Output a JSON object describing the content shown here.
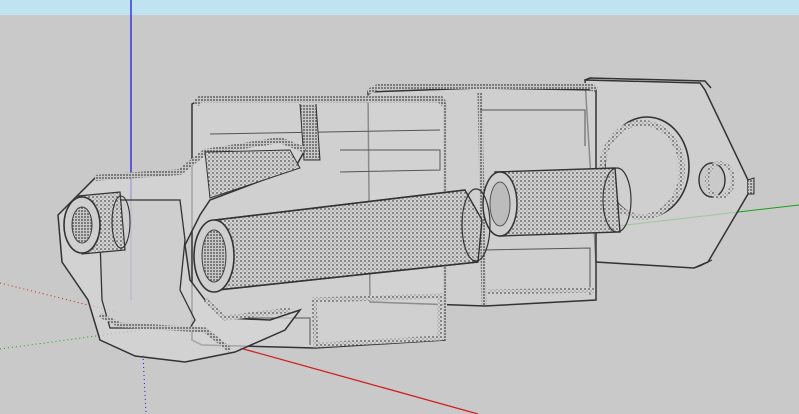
{
  "viewport": {
    "sky_color": "#bfe3f0",
    "ground_color": "#c9c9c9",
    "axis_colors": {
      "red": "#d02020",
      "green": "#18a018",
      "blue": "#2020d8"
    }
  },
  "model": {
    "display_style": "x-ray",
    "line_color": "#3a3a3a",
    "face_color": "#cfcfcf",
    "components": [
      "front-guide-bracket",
      "left-guide-rod",
      "right-guide-rod",
      "main-carriage-block",
      "rear-carriage-block",
      "threaded-rod",
      "motor-mount-plate"
    ]
  }
}
